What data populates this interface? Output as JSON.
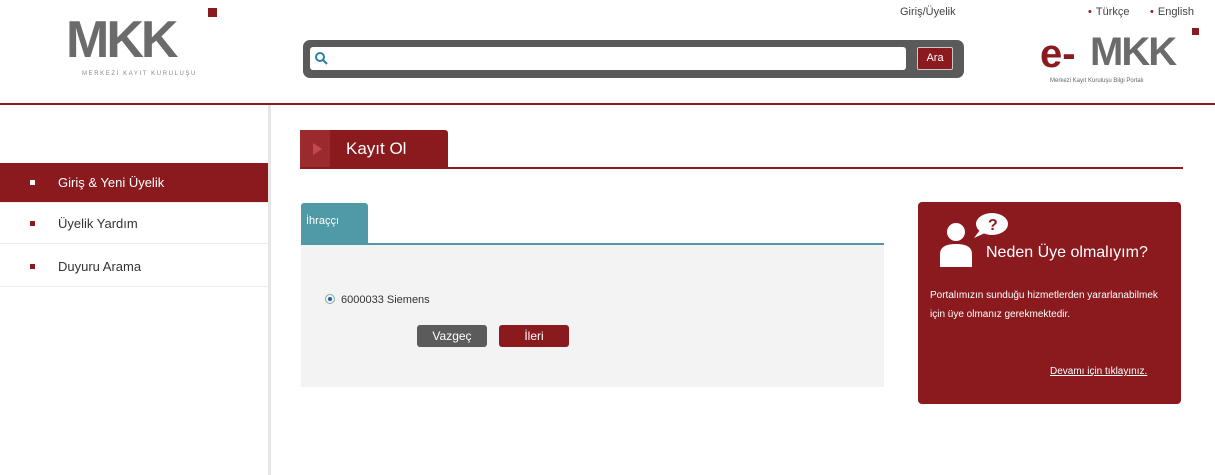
{
  "header": {
    "logo_text": "MKK",
    "logo_sub": "MERKEZİ KAYIT KURULUŞU",
    "search_placeholder": "",
    "search_button": "Ara",
    "giris_link": "Giriş/Üyelik",
    "languages": [
      "Türkçe",
      "English"
    ],
    "emkk_prefix": "e-",
    "emkk_logo": "MKK",
    "emkk_sub": "Merkezi Kayıt Kuruluşu Bilgi Portalı"
  },
  "sidebar": {
    "items": [
      {
        "label": "Giriş & Yeni Üyelik",
        "active": true
      },
      {
        "label": "Üyelik Yardım",
        "active": false
      },
      {
        "label": "Duyuru Arama",
        "active": false
      }
    ]
  },
  "main": {
    "title": "Kayıt Ol",
    "tab_label": "İhraççı",
    "radio_option": "6000033 Siemens",
    "cancel_button": "Vazgeç",
    "next_button": "İleri"
  },
  "info": {
    "title": "Neden Üye olmalıyım?",
    "body": "Portalımızın sunduğu hizmetlerden yararlanabilmek için üye olmanız gerekmektedir.",
    "link": "Devamı için tıklayınız."
  },
  "colors": {
    "brand": "#8b1a1e",
    "teal": "#4f9aa6",
    "dark_gray": "#5a5a5a"
  }
}
